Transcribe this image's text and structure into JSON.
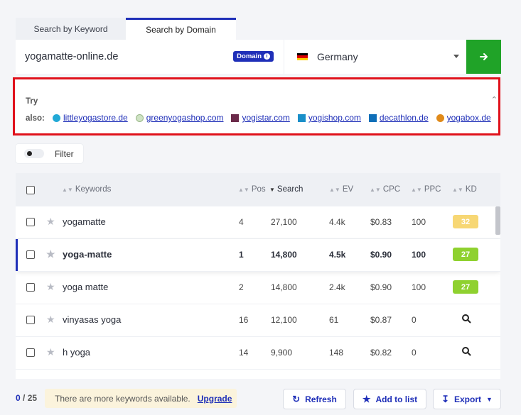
{
  "tabs": [
    {
      "label": "Search by Keyword",
      "active": false
    },
    {
      "label": "Search by Domain",
      "active": true
    }
  ],
  "search": {
    "domain_value": "yogamatte-online.de",
    "domain_badge": "Domain",
    "country": "Germany",
    "go_icon": "arrow-right-icon"
  },
  "try_also": {
    "try_label": "Try",
    "also_label": "also:",
    "links": [
      {
        "label": "littleyogastore.de",
        "icon_color": "#22a9d6"
      },
      {
        "label": "greenyogashop.com",
        "icon_color": "#9ab88a"
      },
      {
        "label": "yogistar.com",
        "icon_color": "#6b2a4a"
      },
      {
        "label": "yogishop.com",
        "icon_color": "#1a8fc9"
      },
      {
        "label": "decathlon.de",
        "icon_color": "#0f6fb8"
      },
      {
        "label": "yogabox.de",
        "icon_color": "#e08a1a"
      }
    ]
  },
  "filter": {
    "label": "Filter"
  },
  "table": {
    "columns": [
      "Keywords",
      "Pos",
      "Search",
      "EV",
      "CPC",
      "PPC",
      "KD"
    ],
    "rows": [
      {
        "keyword": "yogamatte",
        "pos": "4",
        "search": "27,100",
        "ev": "4.4k",
        "cpc": "$0.83",
        "ppc": "100",
        "kd": "32",
        "kd_color": "#f7d774"
      },
      {
        "keyword": "yoga-matte",
        "pos": "1",
        "search": "14,800",
        "ev": "4.5k",
        "cpc": "$0.90",
        "ppc": "100",
        "kd": "27",
        "kd_color": "#8fd12f"
      },
      {
        "keyword": "yoga matte",
        "pos": "2",
        "search": "14,800",
        "ev": "2.4k",
        "cpc": "$0.90",
        "ppc": "100",
        "kd": "27",
        "kd_color": "#8fd12f"
      },
      {
        "keyword": "vinyasas yoga",
        "pos": "16",
        "search": "12,100",
        "ev": "61",
        "cpc": "$0.87",
        "ppc": "0",
        "kd": "",
        "kd_color": ""
      },
      {
        "keyword": "h yoga",
        "pos": "14",
        "search": "9,900",
        "ev": "148",
        "cpc": "$0.82",
        "ppc": "0",
        "kd": "",
        "kd_color": ""
      }
    ]
  },
  "footer": {
    "selected": "0",
    "total": "/ 25",
    "more_text": "There are more keywords available.",
    "upgrade_label": "Upgrade",
    "refresh_label": "Refresh",
    "add_to_list_label": "Add to list",
    "export_label": "Export"
  },
  "colors": {
    "accent": "#1f2fb8",
    "go_button": "#20a328",
    "highlight_border": "#e0111b"
  }
}
